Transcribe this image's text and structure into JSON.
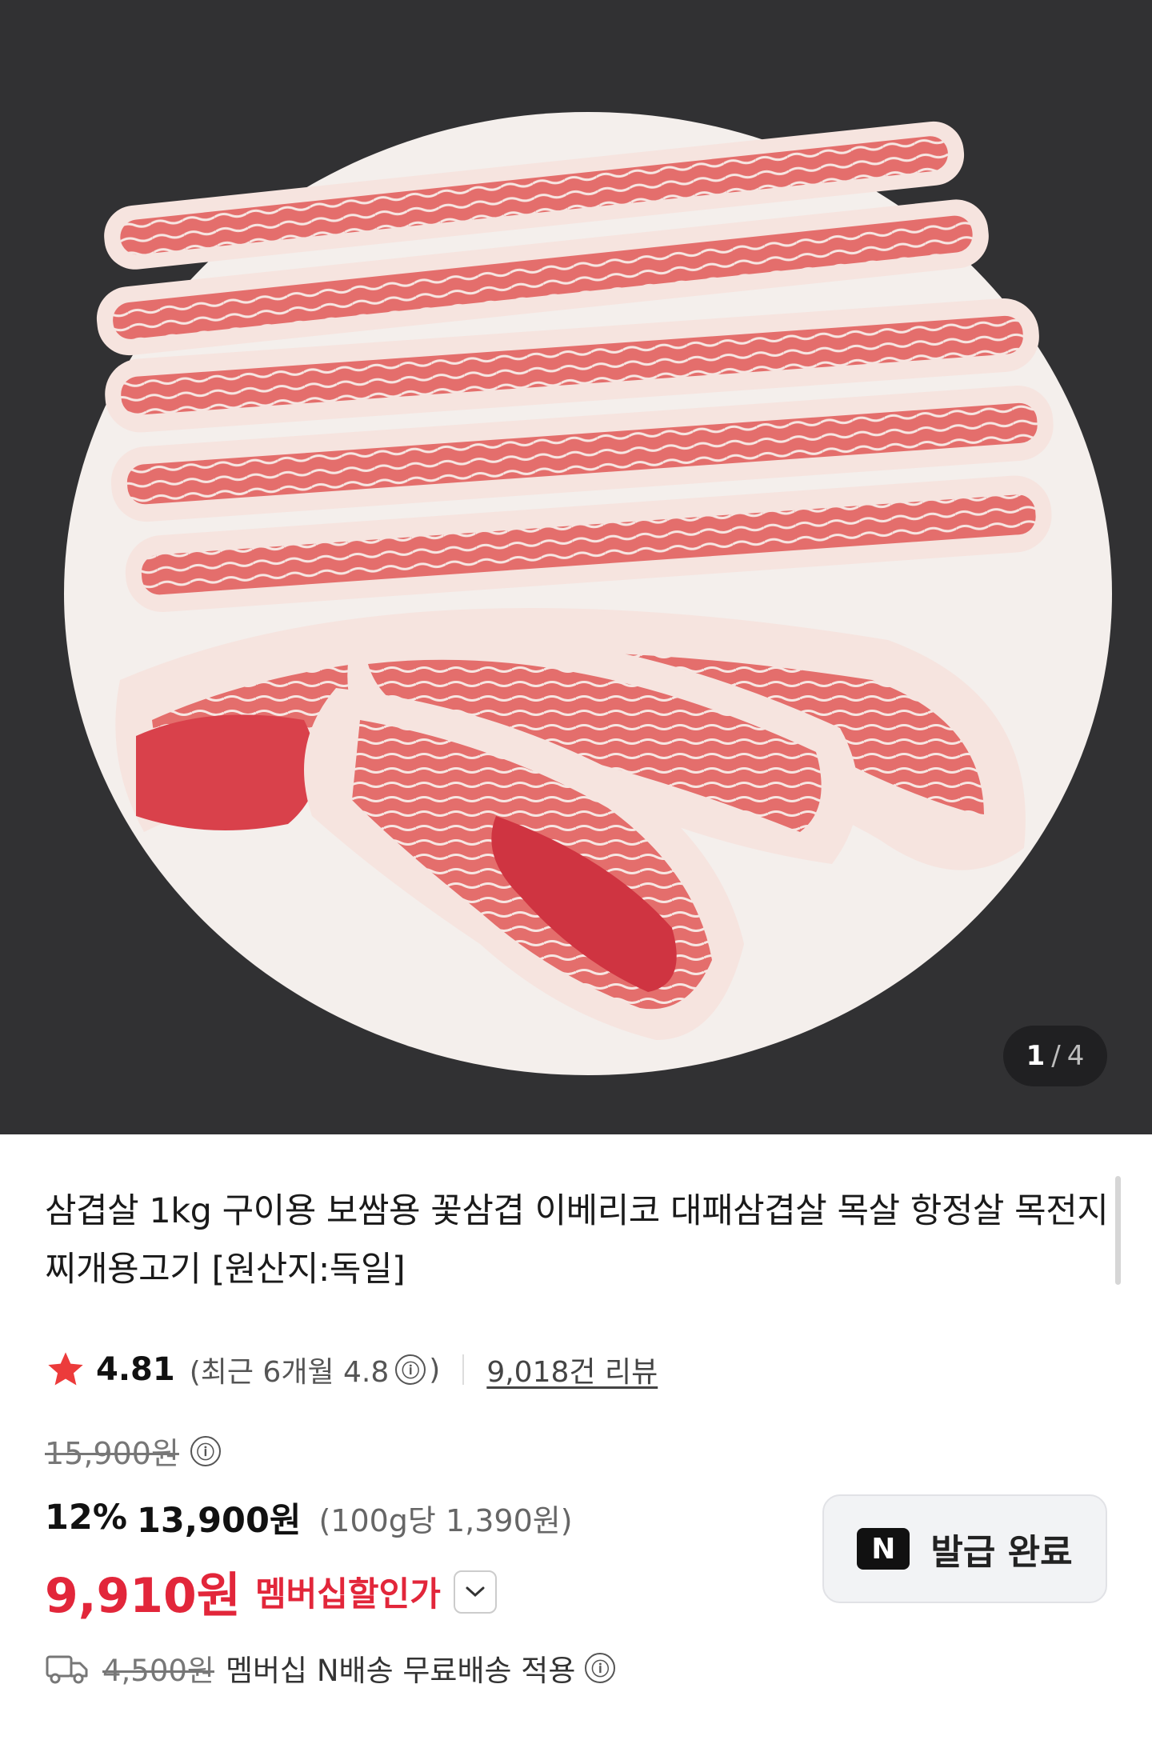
{
  "gallery": {
    "current": "1",
    "separator": "/",
    "total": "4"
  },
  "product": {
    "title": "삼겹살 1kg 구이용 보쌈용 꽃삼겹 이베리코 대패삼겹살 목살 항정살 목전지 찌개용고기 [원산지:독일]"
  },
  "rating": {
    "score": "4.81",
    "recent": "(최근 6개월 4.8",
    "recent_close": ")",
    "review_count": "9,018건 리뷰",
    "info_icon": "ⓘ"
  },
  "price": {
    "original": "15,900원",
    "discount_pct": "12%",
    "sale": "13,900원",
    "unit_price": "(100g당 1,390원)",
    "member_price": "9,910원",
    "member_label": "멤버십할인가"
  },
  "coupon": {
    "logo": "N",
    "label": "발급 완료"
  },
  "shipping": {
    "old_fee": "4,500원",
    "text": "멤버십 N배송 무료배송 적용"
  },
  "colors": {
    "accent_red": "#e2263a",
    "hero_bg": "#313133",
    "star": "#ec3b3b"
  },
  "icons": [
    "star-icon",
    "info-icon",
    "chevron-down-icon",
    "naver-n-icon",
    "truck-icon"
  ]
}
